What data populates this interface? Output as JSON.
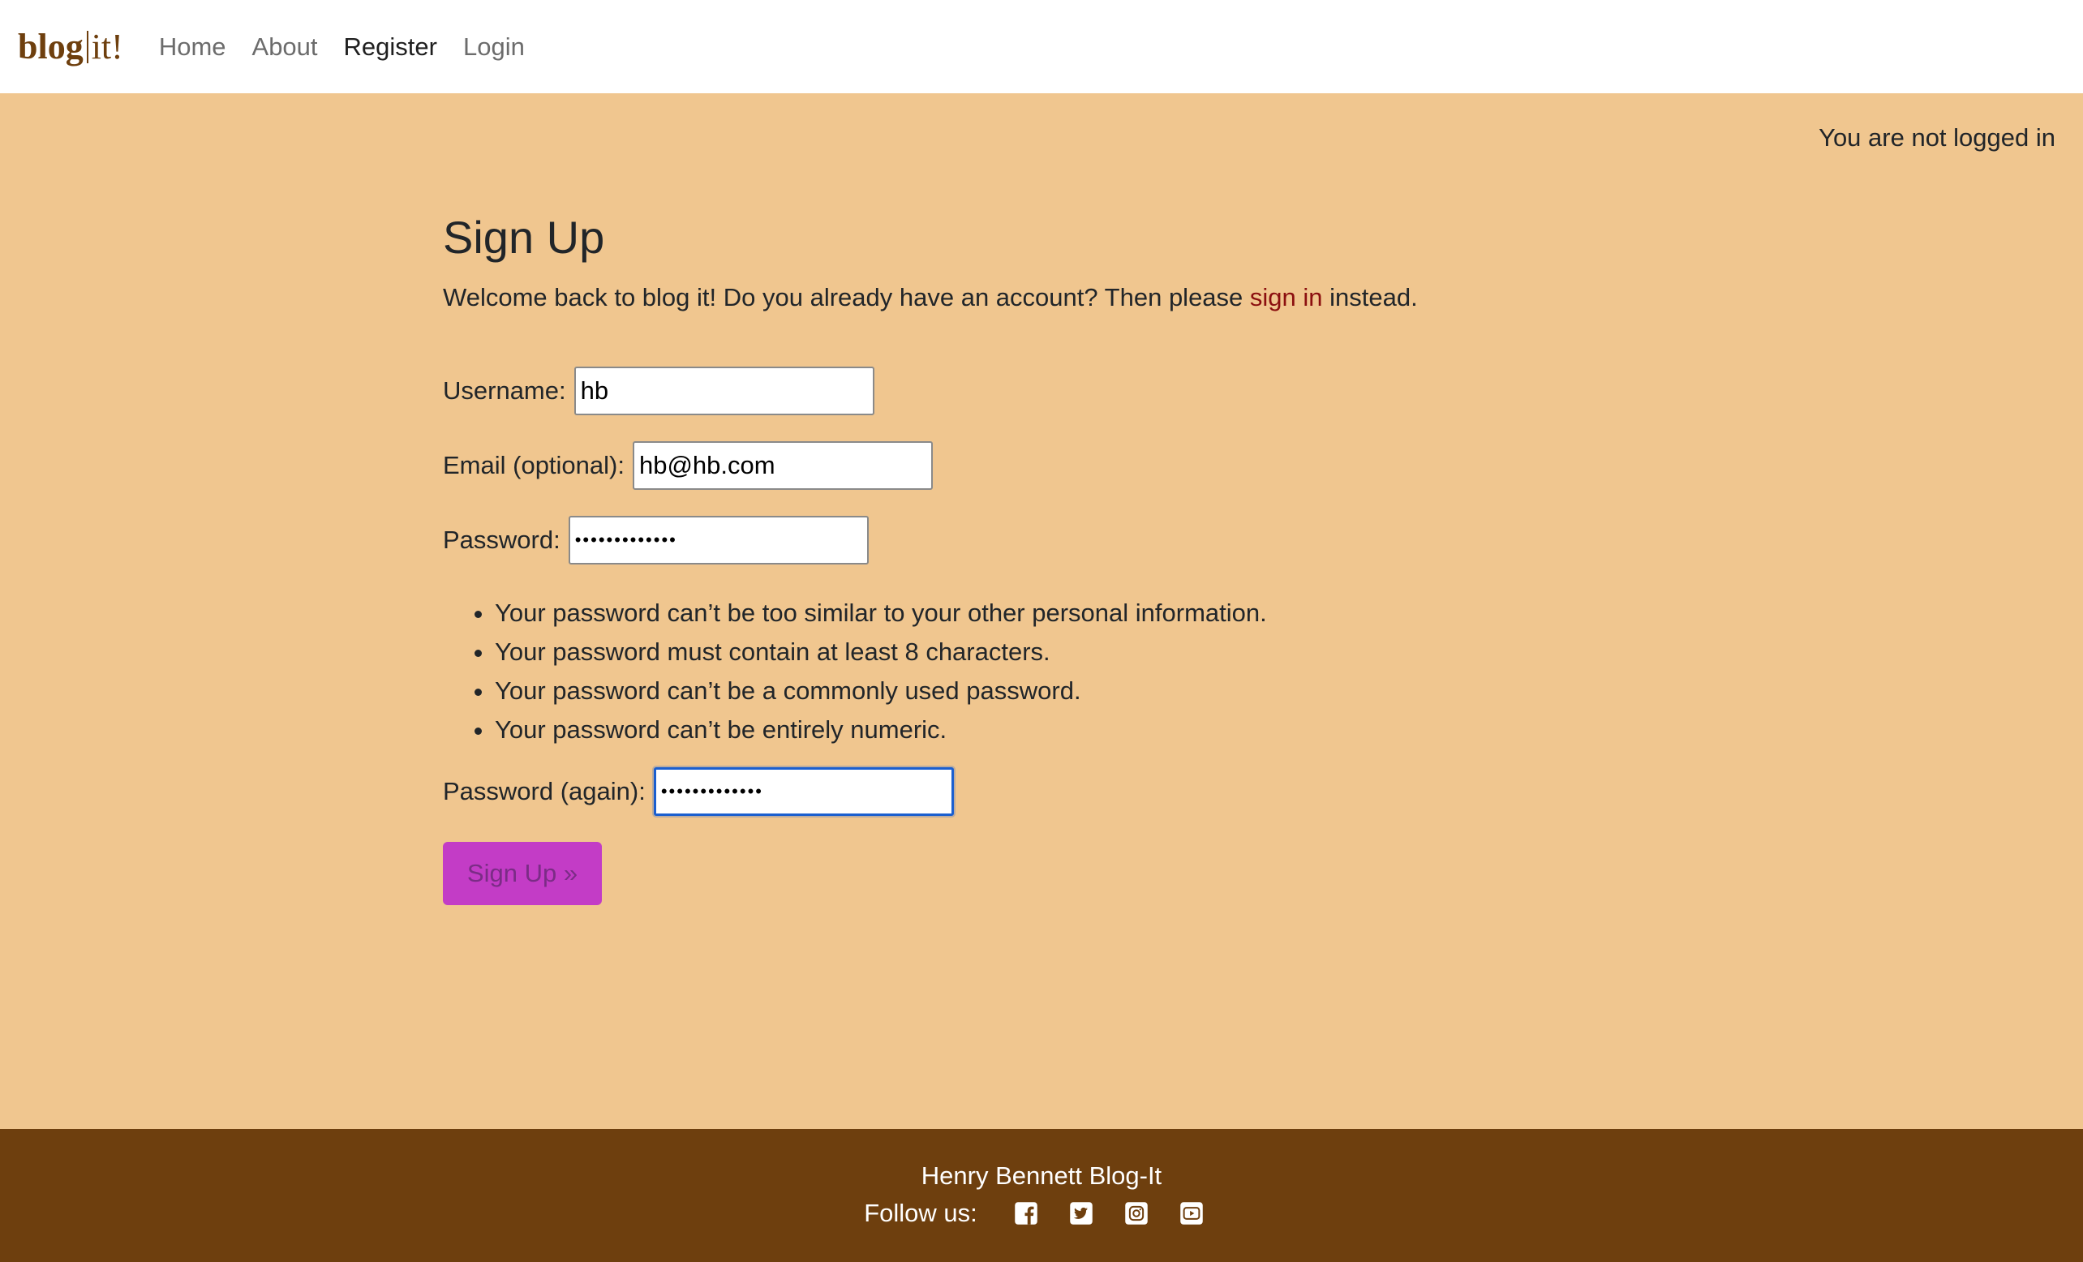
{
  "brand": {
    "part1": "blog",
    "part2": "it!"
  },
  "nav": {
    "items": [
      {
        "label": "Home"
      },
      {
        "label": "About"
      },
      {
        "label": "Register"
      },
      {
        "label": "Login"
      }
    ]
  },
  "status": {
    "text": "You are not logged in"
  },
  "page": {
    "title": "Sign Up",
    "intro_before": "Welcome back to blog it! Do you already have an account? Then please ",
    "intro_link": "sign in",
    "intro_after": " instead."
  },
  "form": {
    "username": {
      "label": "Username:",
      "value": "hb"
    },
    "email": {
      "label": "Email (optional):",
      "value": "hb@hb.com"
    },
    "password": {
      "label": "Password:",
      "value": "•••••••••••••"
    },
    "password_help": [
      "Your password can’t be too similar to your other personal information.",
      "Your password must contain at least 8 characters.",
      "Your password can’t be a commonly used password.",
      "Your password can’t be entirely numeric."
    ],
    "password_again": {
      "label": "Password (again):",
      "value": "•••••••••••••"
    },
    "submit_label": "Sign Up »"
  },
  "footer": {
    "title": "Henry Bennett Blog-It",
    "follow_label": "Follow us:",
    "social_icons": [
      "facebook-icon",
      "twitter-icon",
      "instagram-icon",
      "youtube-icon"
    ]
  },
  "colors": {
    "page_bg": "#f0c68f",
    "brand": "#6e3f0e",
    "footer_bg": "#6e3f0e",
    "link": "#8b0f0f",
    "button_bg": "#c33cc6",
    "button_text": "#7b2c86",
    "focus": "#1b5fcf"
  }
}
